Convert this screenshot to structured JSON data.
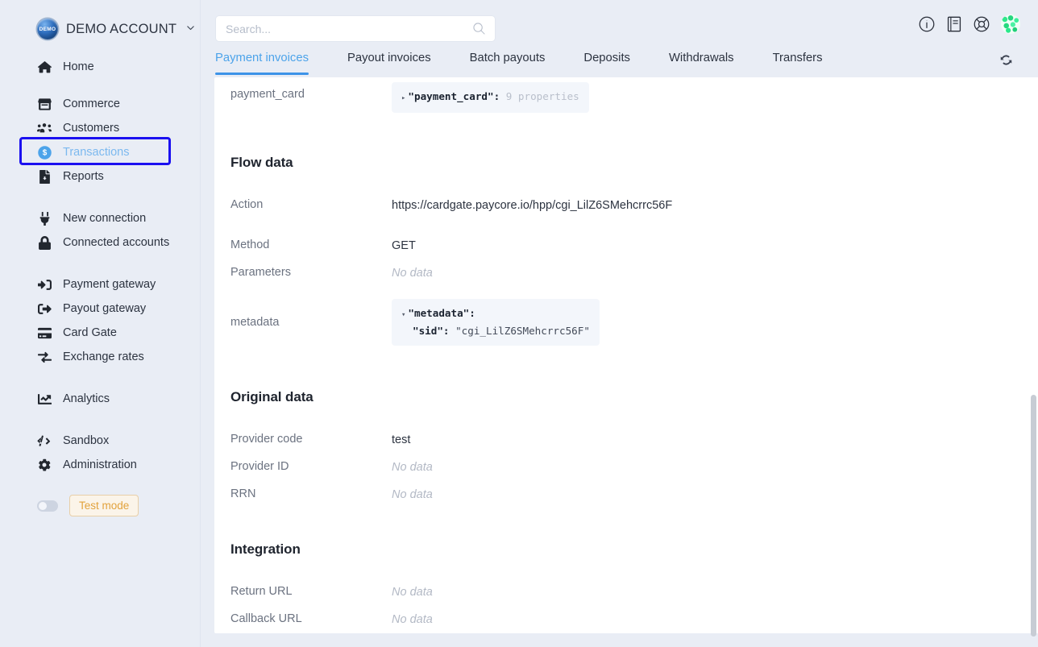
{
  "sidebar": {
    "brand": {
      "logo_text": "DEMO",
      "name": "DEMO ACCOUNT",
      "caret": "⌄"
    },
    "groups": [
      {
        "items": [
          {
            "icon": "home-icon",
            "label": "Home"
          }
        ]
      },
      {
        "items": [
          {
            "icon": "store-icon",
            "label": "Commerce"
          },
          {
            "icon": "users-icon",
            "label": "Customers"
          },
          {
            "icon": "dollar-circle-icon",
            "label": "Transactions",
            "active": true
          },
          {
            "icon": "report-file-icon",
            "label": "Reports"
          }
        ]
      },
      {
        "items": [
          {
            "icon": "plug-icon",
            "label": "New connection"
          },
          {
            "icon": "lock-icon",
            "label": "Connected accounts"
          }
        ]
      },
      {
        "items": [
          {
            "icon": "sign-in-icon",
            "label": "Payment gateway"
          },
          {
            "icon": "sign-out-icon",
            "label": "Payout gateway"
          },
          {
            "icon": "credit-card-icon",
            "label": "Card Gate"
          },
          {
            "icon": "exchange-icon",
            "label": "Exchange rates"
          }
        ]
      },
      {
        "items": [
          {
            "icon": "chart-line-icon",
            "label": "Analytics"
          }
        ]
      },
      {
        "items": [
          {
            "icon": "code-icon",
            "label": "Sandbox"
          },
          {
            "icon": "gear-icon",
            "label": "Administration"
          }
        ]
      }
    ],
    "test_mode_label": "Test mode"
  },
  "header": {
    "search_placeholder": "Search...",
    "search_value": "",
    "icons": [
      "info-circle-icon",
      "book-icon",
      "lifebuoy-icon"
    ],
    "avatar": "user-avatar",
    "refresh": "refresh-icon"
  },
  "tabs": [
    {
      "label": "Payment invoices",
      "active": true
    },
    {
      "label": "Payout invoices",
      "active": false
    },
    {
      "label": "Batch payouts",
      "active": false
    },
    {
      "label": "Deposits",
      "active": false
    },
    {
      "label": "Withdrawals",
      "active": false
    },
    {
      "label": "Transfers",
      "active": false
    }
  ],
  "detail": {
    "payment_card": {
      "label": "payment_card",
      "caret": "▸",
      "key": "\"payment_card\":",
      "summary": "9 properties"
    },
    "flow_data": {
      "title": "Flow data",
      "action_label": "Action",
      "action_value": "https://cardgate.paycore.io/hpp/cgi_LilZ6SMehcrrc56F",
      "method_label": "Method",
      "method_value": "GET",
      "parameters_label": "Parameters",
      "parameters_value": "No data",
      "metadata_label": "metadata",
      "metadata_caret": "▾",
      "metadata_key": "\"metadata\":",
      "metadata_sid_key": "\"sid\":",
      "metadata_sid_value": "\"cgi_LilZ6SMehcrrc56F\""
    },
    "original_data": {
      "title": "Original data",
      "provider_code_label": "Provider code",
      "provider_code_value": "test",
      "provider_id_label": "Provider ID",
      "provider_id_value": "No data",
      "rrn_label": "RRN",
      "rrn_value": "No data"
    },
    "integration": {
      "title": "Integration",
      "return_url_label": "Return URL",
      "return_url_value": "No data",
      "callback_url_label": "Callback URL",
      "callback_url_value": "No data"
    }
  },
  "colors": {
    "accent": "#3d93e8",
    "active_tab": "#4ca3ea",
    "page_bg": "#e9edf5",
    "highlight_box": "#1b10f0",
    "test_mode": "#e2a23c"
  }
}
